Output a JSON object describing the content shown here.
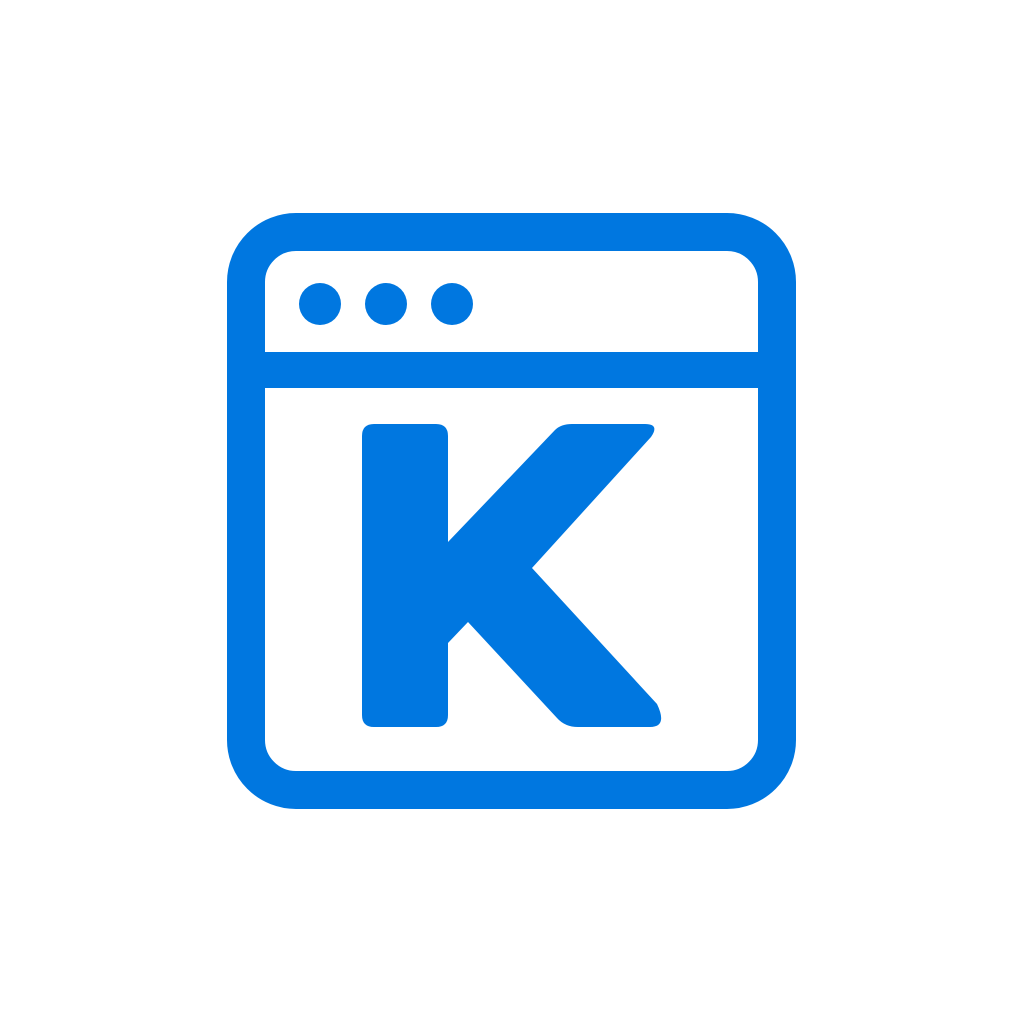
{
  "logo": {
    "letter": "K",
    "icon": "browser-window-k-icon",
    "colors": {
      "accent": "#0077E0",
      "background": "#FFFFFF"
    }
  },
  "window_controls": {
    "dots": [
      {
        "icon": "window-dot-icon"
      },
      {
        "icon": "window-dot-icon"
      },
      {
        "icon": "window-dot-icon"
      }
    ]
  }
}
